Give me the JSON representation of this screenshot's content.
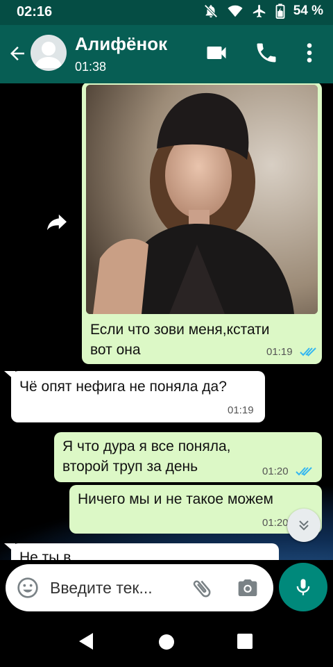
{
  "status_bar": {
    "time": "02:16",
    "battery": "54 %"
  },
  "header": {
    "contact_name": "Алифёнок",
    "contact_status": "01:38"
  },
  "messages": [
    {
      "dir": "out",
      "type": "image",
      "text_line1": "Если что зови меня,кстати",
      "text_line2": "вот она",
      "time": "01:19",
      "read": true
    },
    {
      "dir": "in",
      "text_line1": "Чё опят нефига не поняла да?",
      "time": "01:19"
    },
    {
      "dir": "out",
      "text_line1": "Я что дура я все поняла,",
      "text_line2": "второй труп за день",
      "time": "01:20",
      "read": true
    },
    {
      "dir": "out",
      "text_line1": "Ничего мы и не такое можем",
      "time": "01:20",
      "read": true
    },
    {
      "dir": "in",
      "text_line1": "Не ты в"
    }
  ],
  "input": {
    "placeholder": "Введите тек..."
  },
  "colors": {
    "header": "#075e54",
    "status_bar": "#054d44",
    "outgoing": "#dcf8c6",
    "incoming": "#ffffff",
    "accent": "#00897b",
    "read_ticks": "#34b7f1"
  },
  "icons": [
    "back-arrow-icon",
    "avatar-placeholder-icon",
    "video-call-icon",
    "phone-icon",
    "more-vert-icon",
    "forward-icon",
    "emoji-icon",
    "attach-icon",
    "camera-icon",
    "mic-icon",
    "scroll-down-icon",
    "nav-back-icon",
    "nav-home-icon",
    "nav-recents-icon"
  ]
}
